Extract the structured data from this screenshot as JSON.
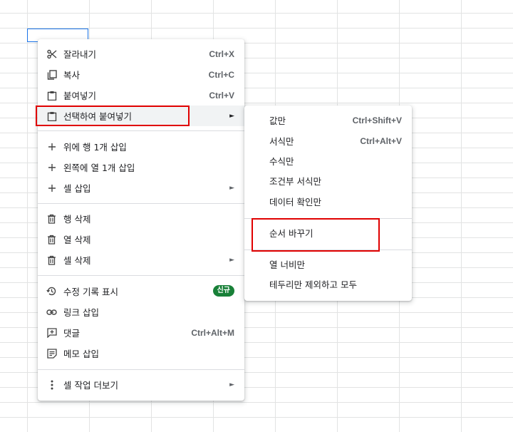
{
  "main_menu": {
    "cut": {
      "label": "잘라내기",
      "shortcut": "Ctrl+X",
      "icon": "scissors-icon"
    },
    "copy": {
      "label": "복사",
      "shortcut": "Ctrl+C",
      "icon": "copy-icon"
    },
    "paste": {
      "label": "붙여넣기",
      "shortcut": "Ctrl+V",
      "icon": "clipboard-icon"
    },
    "paste_special": {
      "label": "선택하여 붙여넣기",
      "arrow": "►",
      "icon": "clipboard-icon"
    },
    "insert_row_above": {
      "label": "위에 행 1개 삽입",
      "icon": "plus-icon"
    },
    "insert_col_left": {
      "label": "왼쪽에 열 1개 삽입",
      "icon": "plus-icon"
    },
    "insert_cells": {
      "label": "셀 삽입",
      "arrow": "►",
      "icon": "plus-icon"
    },
    "delete_row": {
      "label": "행 삭제",
      "icon": "trash-icon"
    },
    "delete_col": {
      "label": "열 삭제",
      "icon": "trash-icon"
    },
    "delete_cells": {
      "label": "셀 삭제",
      "arrow": "►",
      "icon": "trash-icon"
    },
    "edit_history": {
      "label": "수정 기록 표시",
      "badge": "신규",
      "icon": "history-icon"
    },
    "insert_link": {
      "label": "링크 삽입",
      "icon": "link-icon"
    },
    "comment": {
      "label": "댓글",
      "shortcut": "Ctrl+Alt+M",
      "icon": "comment-icon"
    },
    "insert_note": {
      "label": "메모 삽입",
      "icon": "note-icon"
    },
    "more_actions": {
      "label": "셀 작업 더보기",
      "arrow": "►",
      "icon": "more-vert-icon"
    }
  },
  "sub_menu": {
    "values_only": {
      "label": "값만",
      "shortcut": "Ctrl+Shift+V"
    },
    "format_only": {
      "label": "서식만",
      "shortcut": "Ctrl+Alt+V"
    },
    "formula_only": {
      "label": "수식만"
    },
    "conditional_format_only": {
      "label": "조건부 서식만"
    },
    "data_validation_only": {
      "label": "데이터 확인만"
    },
    "transposed": {
      "label": "순서 바꾸기"
    },
    "column_width_only": {
      "label": "열 너비만"
    },
    "all_except_borders": {
      "label": "테두리만 제외하고 모두"
    }
  },
  "colors": {
    "highlight_red": "#e00000",
    "badge_green": "#188038",
    "selection_blue": "#1a73e8"
  }
}
